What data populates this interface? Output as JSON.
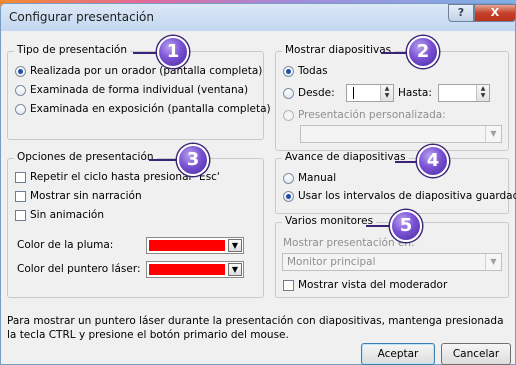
{
  "window": {
    "title": "Configurar presentación",
    "help_label": "?",
    "close_label": "X"
  },
  "badges": [
    "1",
    "2",
    "3",
    "4",
    "5"
  ],
  "tipo": {
    "legend": "Tipo de presentación",
    "options": [
      {
        "label": "Realizada por un orador (pantalla completa)",
        "selected": true
      },
      {
        "label": "Examinada de forma individual (ventana)",
        "selected": false
      },
      {
        "label": "Examinada en exposición (pantalla completa)",
        "selected": false
      }
    ]
  },
  "mostrar": {
    "legend": "Mostrar diapositivas",
    "todas_label": "Todas",
    "desde_label": "Desde:",
    "desde_value": "",
    "hasta_label": "Hasta:",
    "hasta_value": "",
    "personalizada_label": "Presentación personalizada:",
    "personalizada_value": "",
    "selected": "Todas"
  },
  "opciones": {
    "legend": "Opciones de presentación",
    "checks": [
      {
        "label": "Repetir el ciclo hasta presionar 'Esc'",
        "checked": false
      },
      {
        "label": "Mostrar sin narración",
        "checked": false
      },
      {
        "label": "Sin animación",
        "checked": false
      }
    ],
    "pen_color_label": "Color de la pluma:",
    "laser_color_label": "Color del puntero láser:",
    "pen_color": "#ff0000",
    "laser_color": "#ff0000"
  },
  "avance": {
    "legend": "Avance de diapositivas",
    "options": [
      {
        "label": "Manual",
        "selected": false
      },
      {
        "label": "Usar los intervalos de diapositiva guardados",
        "selected": true
      }
    ]
  },
  "monitores": {
    "legend": "Varios monitores",
    "mostrar_en_label": "Mostrar presentación en:",
    "monitor_value": "Monitor principal",
    "moderator_label": "Mostrar vista del moderador",
    "moderator_checked": false
  },
  "footer": {
    "note": "Para mostrar un puntero láser durante la presentación con diapositivas, mantenga presionada la tecla CTRL y presione el botón primario del mouse.",
    "ok_label": "Aceptar",
    "cancel_label": "Cancelar"
  }
}
